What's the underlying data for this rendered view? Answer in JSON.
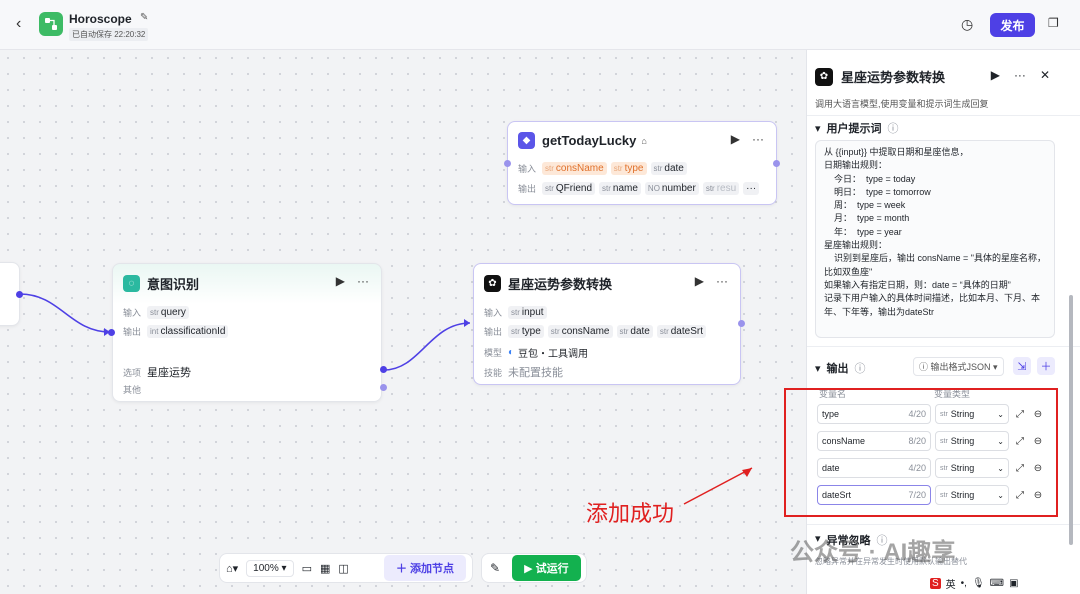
{
  "topbar": {
    "back_icon": "chevron-left-icon",
    "app_title": "Horoscope",
    "saved_text": "已自动保存 22:20:32",
    "publish_label": "发布"
  },
  "nodes": {
    "lucky": {
      "title": "getTodayLucky",
      "input_label": "输入",
      "output_label": "输出",
      "inputs": [
        {
          "type": "str",
          "name": "consName"
        },
        {
          "type": "str",
          "name": "type"
        },
        {
          "type": "str",
          "name": "date"
        }
      ],
      "outputs": [
        {
          "type": "str",
          "name": "QFriend"
        },
        {
          "type": "str",
          "name": "name"
        },
        {
          "type": "NO",
          "name": "number"
        },
        {
          "type": "str",
          "name": "resu"
        }
      ],
      "more_label": "···"
    },
    "intent": {
      "title": "意图识别",
      "input_label": "输入",
      "output_label": "输出",
      "input_tag": {
        "type": "str",
        "name": "query"
      },
      "output_tag": {
        "type": "int",
        "name": "classificationId"
      },
      "option_label": "选项",
      "option_value": "星座运势",
      "other_label": "其他"
    },
    "llm": {
      "title": "星座运势参数转换",
      "input_label": "输入",
      "output_label": "输出",
      "input_tag": {
        "type": "str",
        "name": "input"
      },
      "outputs": [
        {
          "type": "str",
          "name": "type"
        },
        {
          "type": "str",
          "name": "consName"
        },
        {
          "type": "str",
          "name": "date"
        },
        {
          "type": "str",
          "name": "dateSrt"
        }
      ],
      "model_label": "模型",
      "model_value": "豆包・工具调用",
      "skill_label": "技能",
      "skill_value": "未配置技能"
    }
  },
  "toolbar": {
    "zoom": "100%",
    "add_node_label": "添加节点",
    "run_label": "试运行"
  },
  "panel": {
    "title": "星座运势参数转换",
    "description": "调用大语言模型,使用变量和提示词生成回复",
    "prompt_section": "用户提示词",
    "prompt_lines": [
      "从 {{input}} 中提取日期和星座信息，",
      "日期输出规则：",
      "    今日：  type = today",
      "    明日：  type = tomorrow",
      "    周：  type = week",
      "    月：  type = month",
      "    年：  type = year",
      "星座输出规则：",
      "    识别到星座后，输出 consName = \"具体的星座名称，比如双鱼座\"",
      "如果输入有指定日期，则：date = “具体的日期”",
      "记录下用户输入的具体时间描述，比如本月、下月、本年、下年等，输出为dateStr"
    ],
    "output_section": "输出",
    "output_format": "输出格式JSON",
    "col_name": "变量名",
    "col_type": "变量类型",
    "variables": [
      {
        "name": "type",
        "count": "4/20",
        "type_tag": "str",
        "type": "String"
      },
      {
        "name": "consName",
        "count": "8/20",
        "type_tag": "str",
        "type": "String"
      },
      {
        "name": "date",
        "count": "4/20",
        "type_tag": "str",
        "type": "String"
      },
      {
        "name": "dateSrt",
        "count": "7/20",
        "type_tag": "str",
        "type": "String"
      }
    ],
    "error_section": "异常忽略",
    "error_desc": "忽略异常并在异常发生时使用默认输出替代"
  },
  "annotation": {
    "text": "添加成功",
    "color": "#e02020"
  },
  "watermark": "公众号 · AI趣享",
  "ime": {
    "lang": "英"
  },
  "colors": {
    "accent": "#4e40e5",
    "run": "#13b14f",
    "app_icon": "#3dbb65"
  }
}
